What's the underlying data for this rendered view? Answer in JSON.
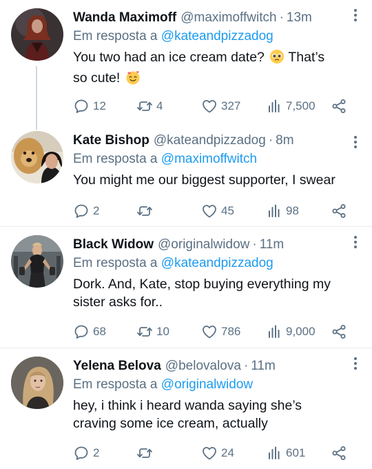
{
  "reply_prefix": "Em resposta a",
  "colors": {
    "mention": "#1d9bf0",
    "secondary_text": "#5b7083",
    "primary_text": "#0f1419",
    "divider": "#e6ecf0"
  },
  "tweets": [
    {
      "name": "Wanda Maximoff",
      "handle": "@maximoffwitch",
      "time": "13m",
      "reply_to": "@kateandpizzadog",
      "text_line1": "You two had an ice cream date?",
      "text_line1_end": "That’s",
      "text_line2": "so cute!",
      "emoji_1": "pleading-face-emoji",
      "emoji_2": "smiling-face-with-hearts-emoji",
      "replies": "12",
      "retweets": "4",
      "likes": "327",
      "views": "7,500"
    },
    {
      "name": "Kate Bishop",
      "handle": "@kateandpizzadog",
      "time": "8m",
      "reply_to": "@maximoffwitch",
      "text": "You might me our biggest supporter, I swear",
      "replies": "2",
      "retweets": "",
      "likes": "45",
      "views": "98"
    },
    {
      "name": "Black Widow",
      "handle": "@originalwidow",
      "time": "11m",
      "reply_to": "@kateandpizzadog",
      "text_line1": "Dork. And, Kate, stop buying everything my",
      "text_line2": "sister asks for..",
      "replies": "68",
      "retweets": "10",
      "likes": "786",
      "views": "9,000"
    },
    {
      "name": "Yelena Belova",
      "handle": "@belovalova",
      "time": "11m",
      "reply_to": "@originalwidow",
      "text_line1": "hey, i think i heard wanda saying she’s",
      "text_line2": "craving some ice cream, actually",
      "replies": "2",
      "retweets": "",
      "likes": "24",
      "views": "601"
    }
  ]
}
